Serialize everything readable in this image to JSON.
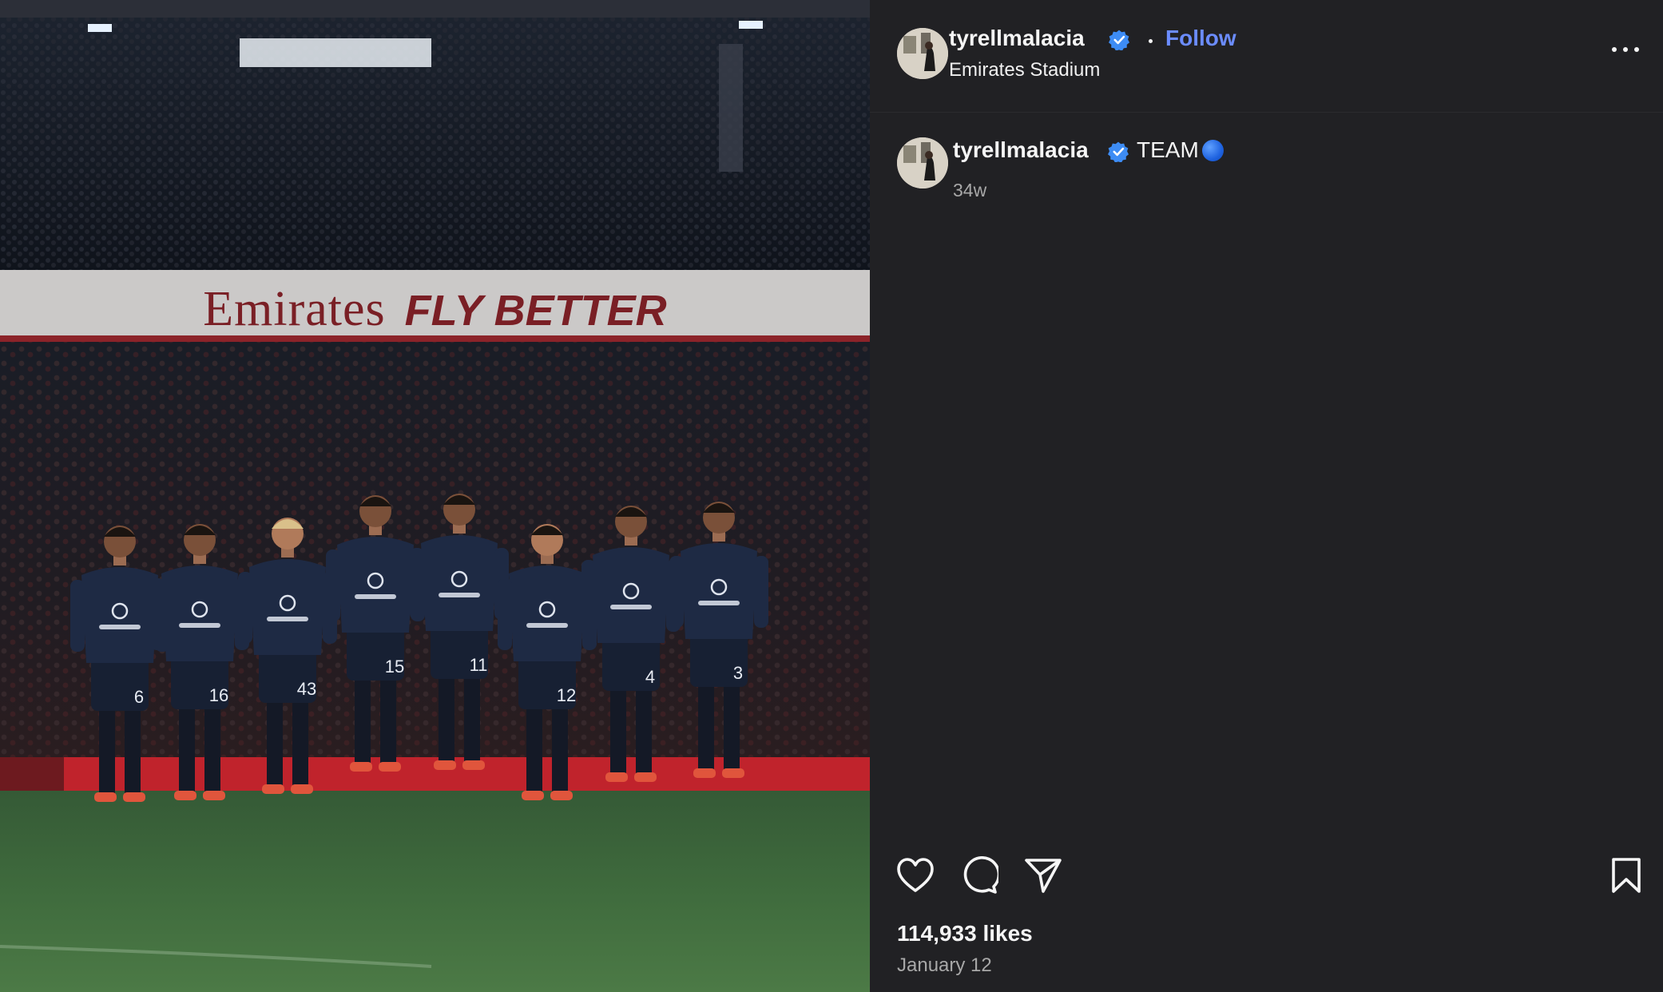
{
  "post": {
    "username": "tyrellmalacia",
    "follow_label": "Follow",
    "location": "Emirates Stadium",
    "caption": "TEAM",
    "caption_emoji": "blue-circle-emoji",
    "age": "34w",
    "likes": "114,933 likes",
    "date": "January 12"
  },
  "photo": {
    "ad_board_brand": "Emirates",
    "ad_board_tagline": "FLY BETTER",
    "shirt_numbers": [
      "6",
      "16",
      "43",
      "15",
      "11",
      "12",
      "4",
      "3"
    ]
  },
  "icons": {
    "verified": "verified-badge-icon",
    "more": "more-options-icon",
    "like": "heart-icon",
    "comment": "comment-icon",
    "share": "send-icon",
    "save": "bookmark-icon"
  },
  "colors": {
    "panel_bg": "#212124",
    "follow": "#6b8cff",
    "verified": "#3d8cf5",
    "secondary_text": "#a8a8a8"
  }
}
